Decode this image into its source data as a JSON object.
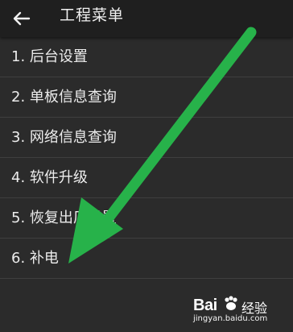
{
  "header": {
    "title": "工程菜单"
  },
  "menu": {
    "items": [
      {
        "label": "1. 后台设置"
      },
      {
        "label": "2. 单板信息查询"
      },
      {
        "label": "3. 网络信息查询"
      },
      {
        "label": "4. 软件升级"
      },
      {
        "label": "5. 恢复出厂设置"
      },
      {
        "label": "6. 补电"
      }
    ]
  },
  "watermark": {
    "logo": "Bai",
    "brand": "经验",
    "url": "jingyan.baidu.com"
  },
  "colors": {
    "arrow": "#27b24a",
    "background": "#2b2b2b",
    "appbar": "#1f1f1f"
  },
  "icons": {
    "back": "arrow-left-icon",
    "paw": "paw-icon"
  }
}
